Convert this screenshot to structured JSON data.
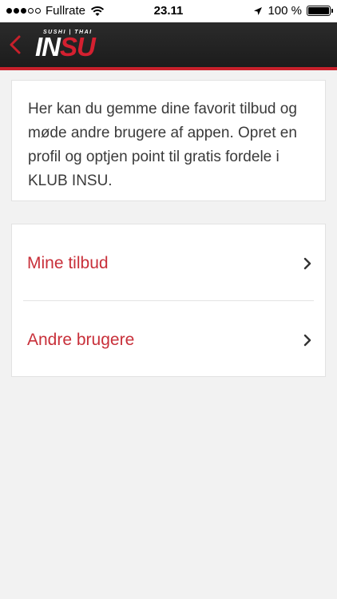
{
  "status_bar": {
    "carrier": "Fullrate",
    "time": "23.11",
    "battery": "100 %"
  },
  "header": {
    "logo_tagline": "SUSHI | THAI",
    "logo_part1": "IN",
    "logo_part2": "SU",
    "accent_color": "#c8202b"
  },
  "intro": {
    "text": "Her kan du gemme dine favorit tilbud og møde andre brugere af appen. Opret en profil og optjen point til gratis fordele i KLUB INSU."
  },
  "menu": {
    "items": [
      {
        "label": "Mine tilbud",
        "icon": "chevron-right-icon"
      },
      {
        "label": "Andre brugere",
        "icon": "chevron-right-icon"
      }
    ]
  }
}
